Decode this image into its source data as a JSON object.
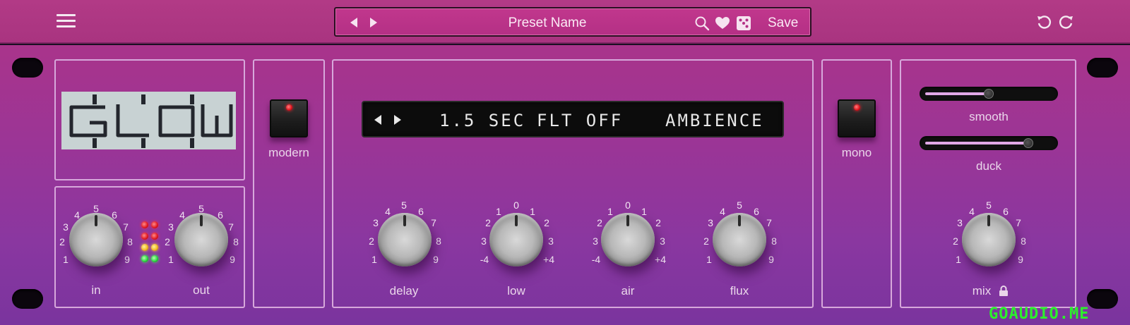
{
  "header": {
    "menu_icon": "hamburger-menu-icon",
    "preset_name": "Preset Name",
    "save_label": "Save",
    "icons": [
      "chevron-left-icon",
      "chevron-right-icon",
      "search-icon",
      "heart-icon",
      "dice-icon",
      "undo-icon",
      "redo-icon"
    ]
  },
  "logo": {
    "text": "GLOW"
  },
  "io": {
    "in_label": "in",
    "out_label": "out",
    "scale": [
      "1",
      "2",
      "3",
      "4",
      "5",
      "6",
      "7",
      "8",
      "9"
    ]
  },
  "modern": {
    "label": "modern",
    "led_on": true
  },
  "mono": {
    "label": "mono",
    "led_on": true
  },
  "display": {
    "time": "1.5 SEC",
    "filter": "FLT OFF",
    "mode": "AMBIENCE"
  },
  "knobs": {
    "delay": {
      "label": "delay",
      "ticks": [
        "1",
        "2",
        "3",
        "4",
        "5",
        "6",
        "7",
        "8",
        "9"
      ]
    },
    "low": {
      "label": "low",
      "ticks": [
        "-4",
        "3",
        "2",
        "1",
        "0",
        "1",
        "2",
        "3",
        "+4"
      ]
    },
    "air": {
      "label": "air",
      "ticks": [
        "-4",
        "3",
        "2",
        "1",
        "0",
        "1",
        "2",
        "3",
        "+4"
      ]
    },
    "flux": {
      "label": "flux",
      "ticks": [
        "1",
        "2",
        "3",
        "4",
        "5",
        "6",
        "7",
        "8",
        "9"
      ]
    },
    "mix": {
      "label": "mix",
      "ticks": [
        "1",
        "2",
        "3",
        "4",
        "5",
        "6",
        "7",
        "8",
        "9"
      ],
      "lock_icon": "lock-icon"
    }
  },
  "sliders": {
    "smooth": {
      "label": "smooth",
      "value": 0.5
    },
    "duck": {
      "label": "duck",
      "value": 0.8
    }
  },
  "watermark": "GOAUDIO.ME",
  "colors": {
    "panel_top": "#a9348b",
    "panel_bottom": "#7a349e",
    "accent": "#b43085",
    "outline": "#d7a8db"
  }
}
